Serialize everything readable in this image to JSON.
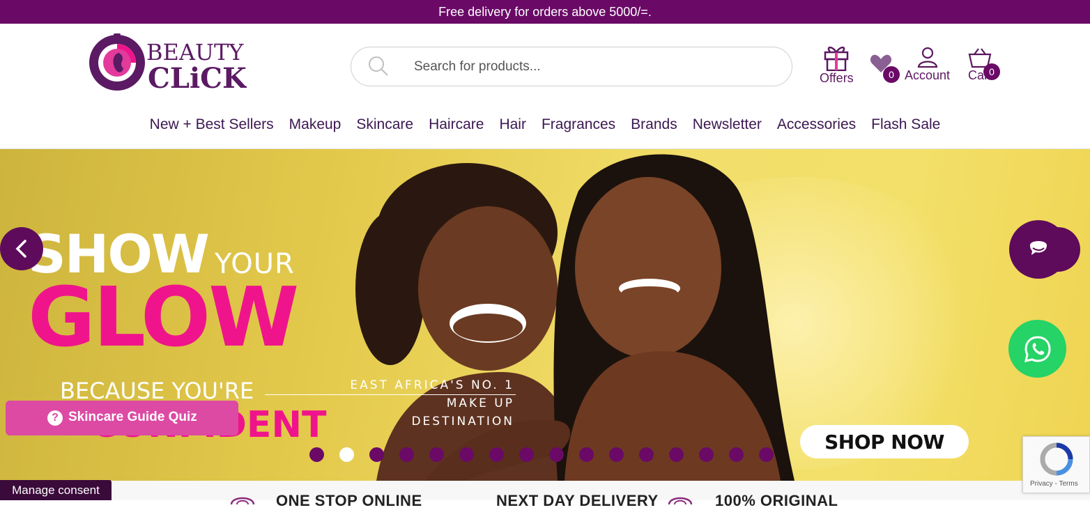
{
  "announcement": "Free delivery for orders above 5000/=.",
  "logo": {
    "line1": "BEAUTY",
    "line2": "CLiCK"
  },
  "search": {
    "placeholder": "Search for products..."
  },
  "header_actions": {
    "offers": "Offers",
    "wishlist_count": "0",
    "account": "Account",
    "cart": "Cart",
    "cart_count": "0"
  },
  "nav": [
    "New + Best Sellers",
    "Makeup",
    "Skincare",
    "Haircare",
    "Hair",
    "Fragrances",
    "Brands",
    "Newsletter",
    "Accessories",
    "Flash Sale"
  ],
  "hero": {
    "show": "SHOW",
    "your": "YOUR",
    "glow": "GLOW",
    "because": "BECAUSE YOU'RE",
    "confident": "CONFIDENT",
    "tagline1": "EAST AFRICA'S NO. 1",
    "tagline2": "MAKE UP DESTINATION",
    "cta": "SHOP NOW",
    "slide_count": 16,
    "active_slide": 2
  },
  "quiz": {
    "label": "Skincare Guide Quiz"
  },
  "features": [
    "ONE STOP ONLINE",
    "NEXT DAY DELIVERY",
    "100% ORIGINAL"
  ],
  "consent": "Manage consent",
  "recaptcha": {
    "links": "Privacy - Terms"
  },
  "colors": {
    "brand": "#6a0a66",
    "pink": "#f0148c",
    "hero_yellow": "#e9d257",
    "whatsapp": "#25d366"
  }
}
